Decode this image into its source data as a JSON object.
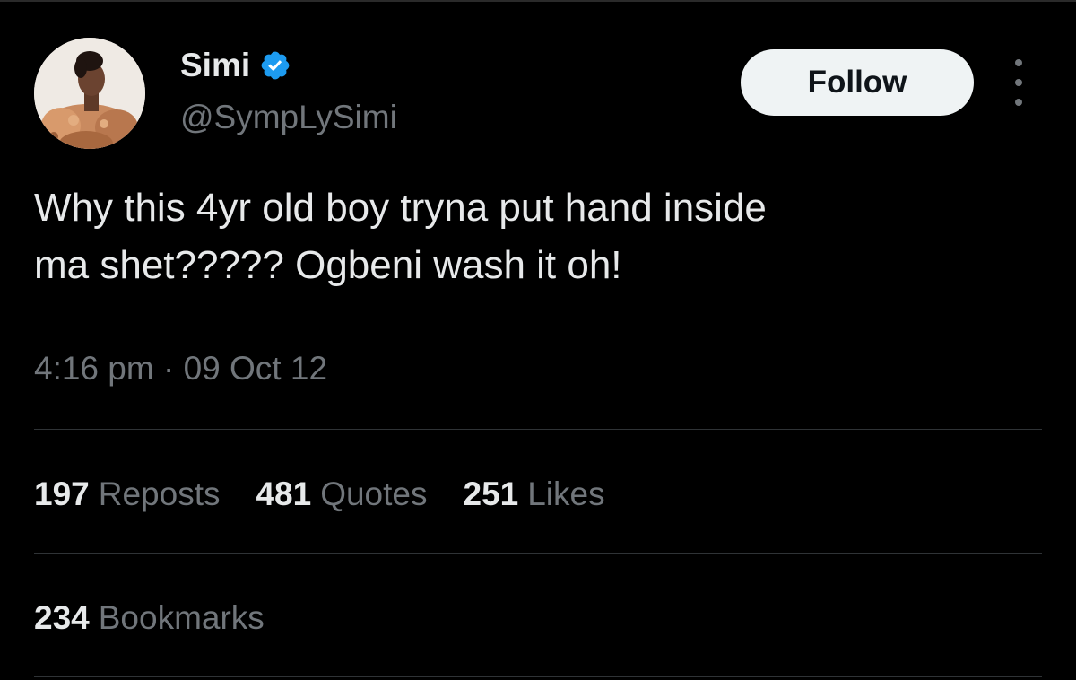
{
  "tweet": {
    "author": {
      "display_name": "Simi",
      "handle": "@SympLySimi",
      "verified": true,
      "verified_icon": "verified-badge-icon",
      "avatar_icon": "profile-photo"
    },
    "follow_label": "Follow",
    "more_icon": "more-vertical-icon",
    "text_line1": "Why this 4yr old boy tryna put hand inside",
    "text_line2": "ma shet????? Ogbeni wash it oh!",
    "time": "4:16 pm",
    "separator": "·",
    "date": "09 Oct 12"
  },
  "stats": {
    "reposts": {
      "count": "197",
      "label": "Reposts"
    },
    "quotes": {
      "count": "481",
      "label": "Quotes"
    },
    "likes": {
      "count": "251",
      "label": "Likes"
    },
    "bookmarks": {
      "count": "234",
      "label": "Bookmarks"
    }
  },
  "colors": {
    "background": "#000000",
    "primary_text": "#e7e9ea",
    "secondary_text": "#71767b",
    "divider": "#2f3336",
    "verified_blue": "#1d9bf0",
    "follow_button_bg": "#eff3f4"
  }
}
